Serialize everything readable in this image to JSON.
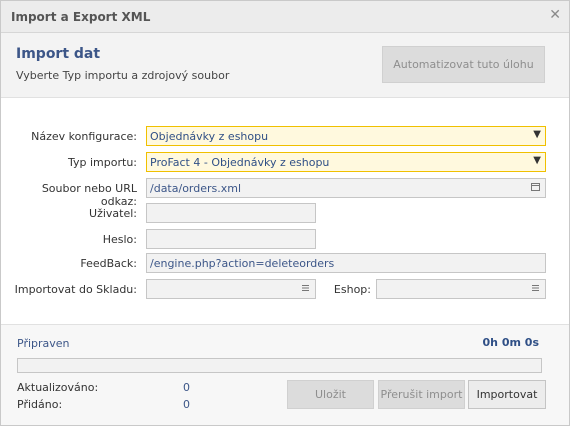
{
  "window": {
    "title": "Import a Export XML",
    "close_icon": "close-icon"
  },
  "header": {
    "title": "Import dat",
    "subtitle": "Vyberte Typ importu a zdrojový soubor",
    "automate_label": "Automatizovat tuto úlohu"
  },
  "form": {
    "config": {
      "label": "Název konfigurace:",
      "value": "Objednávky z eshopu"
    },
    "import_type": {
      "label": "Typ importu:",
      "value": "ProFact 4 - Objednávky z eshopu"
    },
    "source": {
      "label": "Soubor nebo URL odkaz:",
      "value": "/data/orders.xml",
      "icon": "calendar-icon"
    },
    "user": {
      "label": "Uživatel:",
      "value": ""
    },
    "password": {
      "label": "Heslo:",
      "value": ""
    },
    "feedback": {
      "label": "FeedBack:",
      "value": "/engine.php?action=deleteorders"
    },
    "warehouse": {
      "label": "Importovat do Skladu:",
      "value": "",
      "icon": "list-icon"
    },
    "eshop": {
      "label": "Eshop:",
      "value": "",
      "icon": "list-icon"
    }
  },
  "footer": {
    "status": "Připraven",
    "timer": "0h 0m 0s",
    "progress": 0,
    "updated_label": "Aktualizováno:",
    "updated_value": "0",
    "added_label": "Přidáno:",
    "added_value": "0",
    "save_label": "Uložit",
    "stop_label": "Přerušit import",
    "import_label": "Importovat"
  },
  "colors": {
    "accent": "#3c5688",
    "highlight_border": "#f0c000",
    "highlight_bg": "#fff9de"
  }
}
